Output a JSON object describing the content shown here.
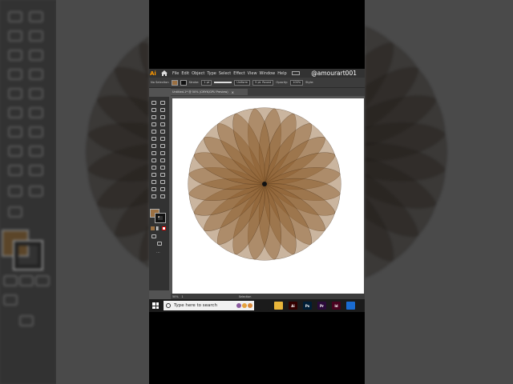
{
  "app": {
    "logo": "Ai",
    "menus": [
      "File",
      "Edit",
      "Object",
      "Type",
      "Select",
      "Effect",
      "View",
      "Window",
      "Help"
    ],
    "watermark": "@amourart001"
  },
  "control_bar": {
    "selection_label": "No Selection",
    "stroke_label": "Stroke:",
    "stroke_weight": "1 pt",
    "profile": "Uniform",
    "brush": "5 pt. Round",
    "opacity_label": "Opacity:",
    "opacity_value": "100%",
    "style_label": "Style:"
  },
  "document": {
    "tab_title": "Untitled-1* @ 50% (CMYK/GPU Preview)",
    "close": "×"
  },
  "status_bar": {
    "zoom": "50%",
    "artboard": "1",
    "tool": "Selection"
  },
  "taskbar": {
    "search_placeholder": "Type here to search",
    "apps": [
      {
        "name": "Task View",
        "color": "#1b1b1b",
        "label": ""
      },
      {
        "name": "File Explorer",
        "color": "#e8b53a",
        "label": ""
      },
      {
        "name": "Illustrator",
        "color": "#330000",
        "label": "Ai"
      },
      {
        "name": "Photoshop",
        "color": "#001e36",
        "label": "Ps"
      },
      {
        "name": "Premiere Pro",
        "color": "#2a0a3a",
        "label": "Pr"
      },
      {
        "name": "InDesign",
        "color": "#49021f",
        "label": "Id"
      },
      {
        "name": "Mail",
        "color": "#1a6bd0",
        "label": ""
      }
    ]
  },
  "colors": {
    "fill": "#9b7042",
    "stroke": "#111111",
    "petal": "#8a5a2b",
    "accent": "#ff9a00"
  },
  "artwork": {
    "petal_count": 24,
    "petal_opacity": 0.45
  }
}
